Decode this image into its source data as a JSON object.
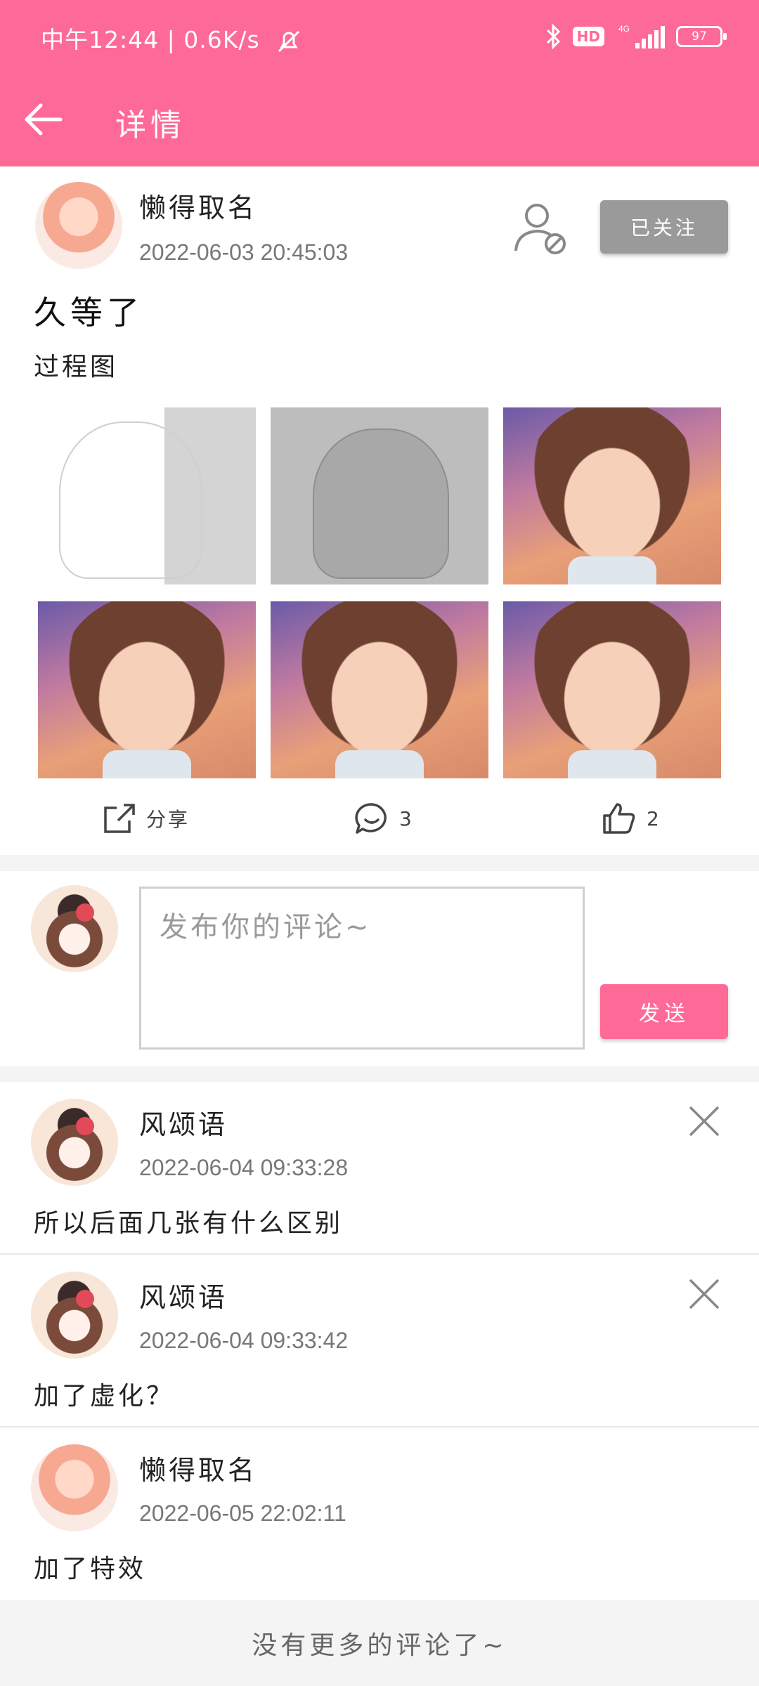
{
  "status_bar": {
    "time": "中午12:44",
    "speed": "0.6K/s",
    "hd_label": "HD",
    "network_label": "4G",
    "battery": "97"
  },
  "nav": {
    "title": "详情"
  },
  "post": {
    "author": "懒得取名",
    "time": "2022-06-03  20:45:03",
    "follow_label": "已关注",
    "title": "久等了",
    "body": "过程图",
    "images": [
      "sketch",
      "gray",
      "color",
      "color",
      "color",
      "color"
    ],
    "actions": {
      "share_label": "分享",
      "comment_count": "3",
      "like_count": "2"
    }
  },
  "comment_box": {
    "placeholder": "发布你的评论~",
    "send_label": "发送"
  },
  "comments": [
    {
      "author": "风颂语",
      "time": "2022-06-04  09:33:28",
      "text": "所以后面几张有什么区别",
      "deletable": true
    },
    {
      "author": "风颂语",
      "time": "2022-06-04  09:33:42",
      "text": "加了虚化？",
      "deletable": true
    },
    {
      "author": "懒得取名",
      "time": "2022-06-05  22:02:11",
      "text": "加了特效",
      "deletable": false
    }
  ],
  "footer": {
    "no_more": "没有更多的评论了~"
  },
  "colors": {
    "accent": "#fe6a98",
    "follow_gray": "#9a9a9a"
  }
}
